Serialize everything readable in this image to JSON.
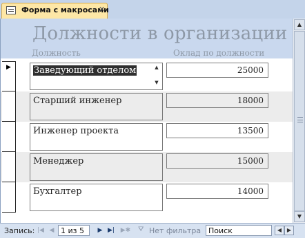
{
  "tab": {
    "title": "Форма с макросами",
    "close_glyph": "✕"
  },
  "form": {
    "title": "Должности в организации",
    "column_position": "Должность",
    "column_salary": "Оклад по должности"
  },
  "records": [
    {
      "position": "Заведующий отделом",
      "salary": "25000",
      "selected": true
    },
    {
      "position": "Старший инженер",
      "salary": "18000",
      "selected": false
    },
    {
      "position": "Инженер проекта",
      "salary": "13500",
      "selected": false
    },
    {
      "position": "Менеджер",
      "salary": "15000",
      "selected": false
    },
    {
      "position": "Бухгалтер",
      "salary": "14000",
      "selected": false
    }
  ],
  "navigation": {
    "label": "Запись:",
    "first": "|◀",
    "prev": "◀",
    "record_text": "1 из 5",
    "next": "▶",
    "last": "▶|",
    "new": "▶✱",
    "filter_label": "Нет фильтра",
    "search_placeholder": "Поиск"
  },
  "icons": {
    "tab": "form-icon",
    "filter": "funnel-icon",
    "record_selector": "current-record-arrow-icon"
  },
  "colors": {
    "header_bg": "#c9d8ee",
    "title_text": "#8d98a6",
    "tab_bg": "#fde7a6",
    "alt_row_bg": "#ececec"
  }
}
